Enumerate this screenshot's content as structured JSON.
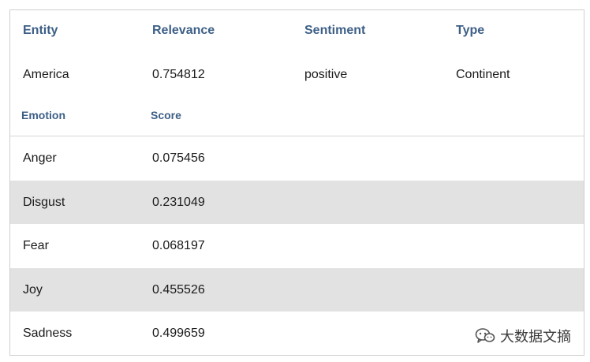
{
  "entity_table": {
    "headers": [
      "Entity",
      "Relevance",
      "Sentiment",
      "Type"
    ],
    "row": [
      "America",
      "0.754812",
      "positive",
      "Continent"
    ]
  },
  "emotion_table": {
    "headers": [
      "Emotion",
      "Score"
    ],
    "rows": [
      {
        "emotion": "Anger",
        "score": "0.075456"
      },
      {
        "emotion": "Disgust",
        "score": "0.231049"
      },
      {
        "emotion": "Fear",
        "score": "0.068197"
      },
      {
        "emotion": "Joy",
        "score": "0.455526"
      },
      {
        "emotion": "Sadness",
        "score": "0.499659"
      }
    ]
  },
  "watermark": {
    "text": "大数据文摘",
    "icon": "wechat-icon"
  },
  "colors": {
    "header_text": "#3d5f86",
    "alt_row_bg": "#e2e2e2",
    "border": "#cfcfcf"
  }
}
